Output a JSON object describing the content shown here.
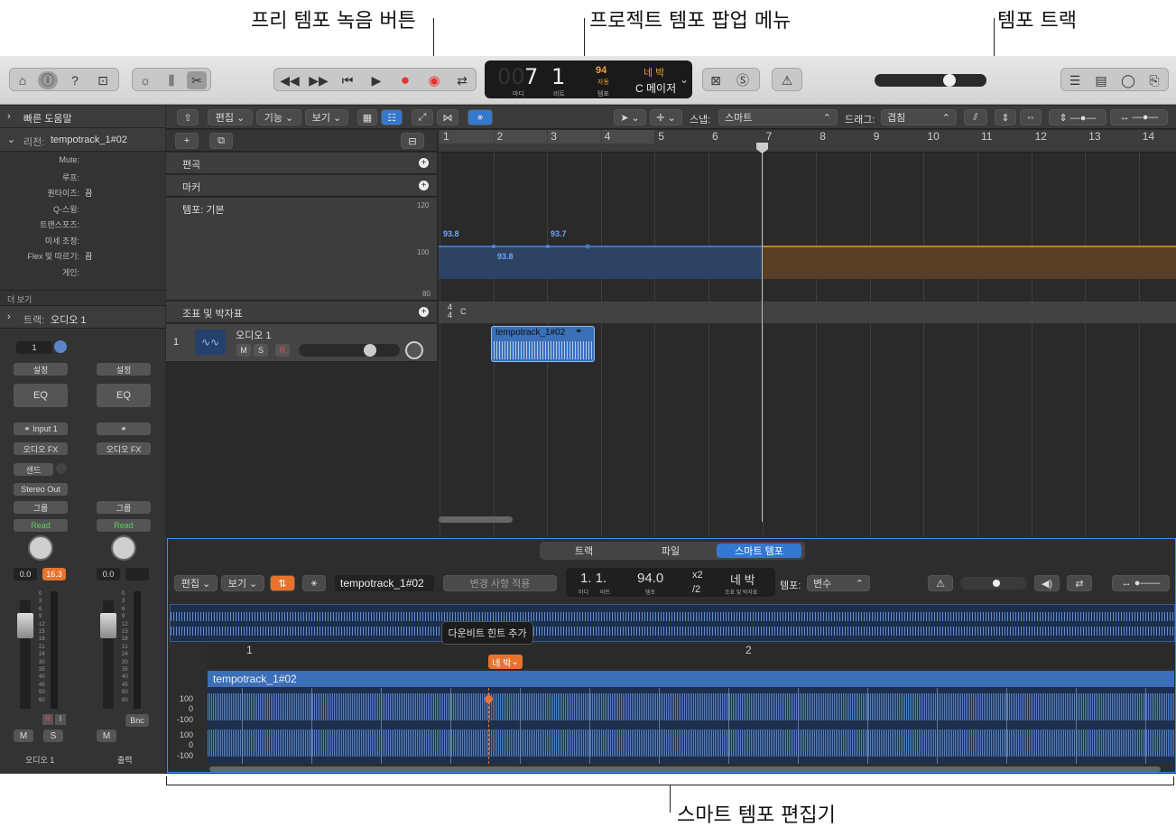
{
  "callouts": {
    "free_tempo": "프리 템포 녹음 버튼",
    "project_tempo": "프로젝트 템포 팝업 메뉴",
    "tempo_track": "템포 트랙",
    "smart_tempo_editor": "스마트 템포 편집기"
  },
  "lcd": {
    "bar_dim": "00",
    "bar": "7",
    "beat": "1",
    "bar_label": "마디",
    "beat_label": "비트",
    "tempo": "94",
    "tempo_mode": "자동",
    "tempo_label": "템포",
    "signature": "네 박",
    "key": "C 메이저"
  },
  "inspector": {
    "quick_help": "빠른 도움말",
    "region_prefix": "리전:",
    "region_name": "tempotrack_1#02",
    "params": [
      {
        "label": "Mute:",
        "value": ""
      },
      {
        "label": "루프:",
        "value": ""
      },
      {
        "label": "퀀타이즈:",
        "value": "끔"
      },
      {
        "label": "Q-스윙:",
        "value": ""
      },
      {
        "label": "트랜스포즈:",
        "value": ""
      },
      {
        "label": "미세 조정:",
        "value": ""
      },
      {
        "label": "Flex 및 따르기:",
        "value": "끔"
      },
      {
        "label": "게인:",
        "value": ""
      }
    ],
    "more": "더 보기",
    "track_prefix": "트랙:",
    "track_name": "오디오 1"
  },
  "strip1": {
    "num": "1",
    "setting": "설정",
    "eq": "EQ",
    "input": "Input 1",
    "fx": "오디오 FX",
    "send": "센드",
    "out": "Stereo Out",
    "group": "그룹",
    "auto": "Read",
    "vol": "0.0",
    "peak": "16.3",
    "name": "오디오 1"
  },
  "strip2": {
    "setting": "설정",
    "eq": "EQ",
    "fx": "오디오 FX",
    "group": "그룹",
    "auto": "Read",
    "vol": "0.0",
    "bnc": "Bnc",
    "name": "출력"
  },
  "meter_scale": [
    "0",
    "3",
    "6",
    "9",
    "12",
    "15",
    "18",
    "21",
    "24",
    "30",
    "35",
    "40",
    "45",
    "50",
    "60"
  ],
  "menubar": {
    "edit": "편집",
    "function": "기능",
    "view": "보기",
    "snap_label": "스냅:",
    "snap_value": "스마트",
    "drag_label": "드래그:",
    "drag_value": "겹침"
  },
  "ruler": [
    "1",
    "2",
    "3",
    "4",
    "5",
    "6",
    "7",
    "8",
    "9",
    "10",
    "11",
    "12",
    "13",
    "14"
  ],
  "global_tracks": {
    "arrangement": "편곡",
    "marker": "마커",
    "tempo": "템포: 기본",
    "tempo_scale": [
      "120",
      "100",
      "80"
    ],
    "tempo_values": [
      "93.8",
      "93.8",
      "93.7"
    ],
    "signature": "조표 및 박자표",
    "sig_top": "4",
    "sig_bottom": "4",
    "sig_key": "C"
  },
  "track": {
    "num": "1",
    "name": "오디오 1",
    "m": "M",
    "s": "S",
    "r": "R",
    "region": "tempotrack_1#02"
  },
  "editor": {
    "tabs": [
      "트랙",
      "파일",
      "스마트 템포"
    ],
    "edit": "편집",
    "view": "보기",
    "region_name": "tempotrack_1#02",
    "apply": "변경 사항 적용",
    "pos": "1. 1.",
    "pos_label_bar": "마디",
    "pos_label_beat": "비트",
    "tempo": "94.0",
    "tempo_label": "템포",
    "x2": "x2",
    "div2": "/2",
    "sig": "네 박",
    "sig_label": "조표 및 박자표",
    "tempo_mode_label": "템포:",
    "tempo_mode": "변수",
    "tooltip": "다운비트 힌트 추가",
    "beat_badge": "네 박",
    "ruler": [
      "1",
      "2"
    ],
    "region": "tempotrack_1#02",
    "scale": [
      "100",
      "0",
      "-100",
      "100",
      "0",
      "-100"
    ]
  }
}
